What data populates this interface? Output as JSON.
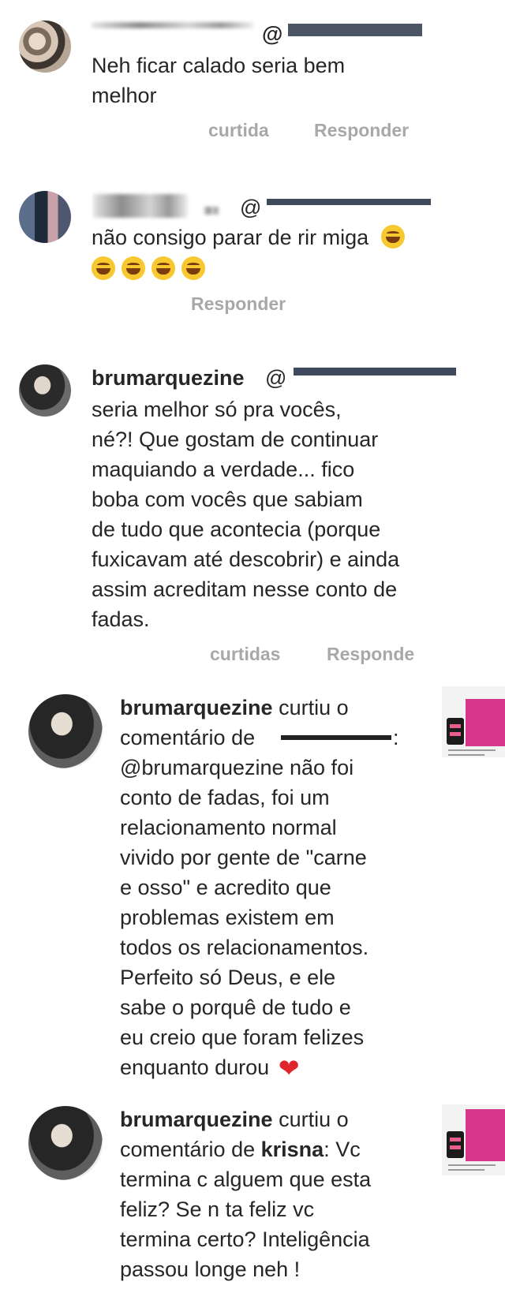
{
  "comments": [
    {
      "text_lines": [
        "Neh ficar calado seria bem",
        "melhor"
      ],
      "mention": "@",
      "actions": [
        "curtida",
        "Responder"
      ]
    },
    {
      "mention": "@",
      "text_line1": "não consigo parar de rir miga",
      "emoji_icon": "laughing-face-emoji",
      "actions": [
        "Responder"
      ]
    },
    {
      "username": "brumarquezine",
      "mention": "@",
      "text_lines": [
        "seria melhor só pra vocês,",
        "né?! Que gostam de continuar",
        "maquiando a verdade... fico",
        "boba com vocês que sabiam",
        "de tudo que acontecia (porque",
        "fuxicavam até descobrir) e ainda",
        "assim acreditam nesse conto de",
        "fadas."
      ],
      "actions": [
        "curtidas",
        "Responde"
      ]
    }
  ],
  "notifications": [
    {
      "username": "brumarquezine",
      "liked_text": "curtiu o",
      "comment_of": "comentário de",
      "colon": ":",
      "text_lines": [
        "@brumarquezine não foi",
        "conto de fadas, foi um",
        "relacionamento normal",
        "vivido por gente de \"carne",
        "e osso\" e acredito que",
        "problemas existem em",
        "todos os relacionamentos.",
        "Perfeito só Deus, e ele",
        "sabe o porquê de tudo e",
        "eu creio que foram felizes"
      ],
      "last_line": "enquanto durou",
      "heart_icon": "red-heart-emoji"
    },
    {
      "username": "brumarquezine",
      "liked_text": "curtiu o",
      "comment_of": "comentário de",
      "commenter": "krisna",
      "first_line_tail": ": Vc",
      "text_lines": [
        "termina c alguem que esta",
        "feliz?  Se n ta feliz vc",
        "termina certo?  Inteligência",
        "passou longe neh !"
      ]
    }
  ]
}
